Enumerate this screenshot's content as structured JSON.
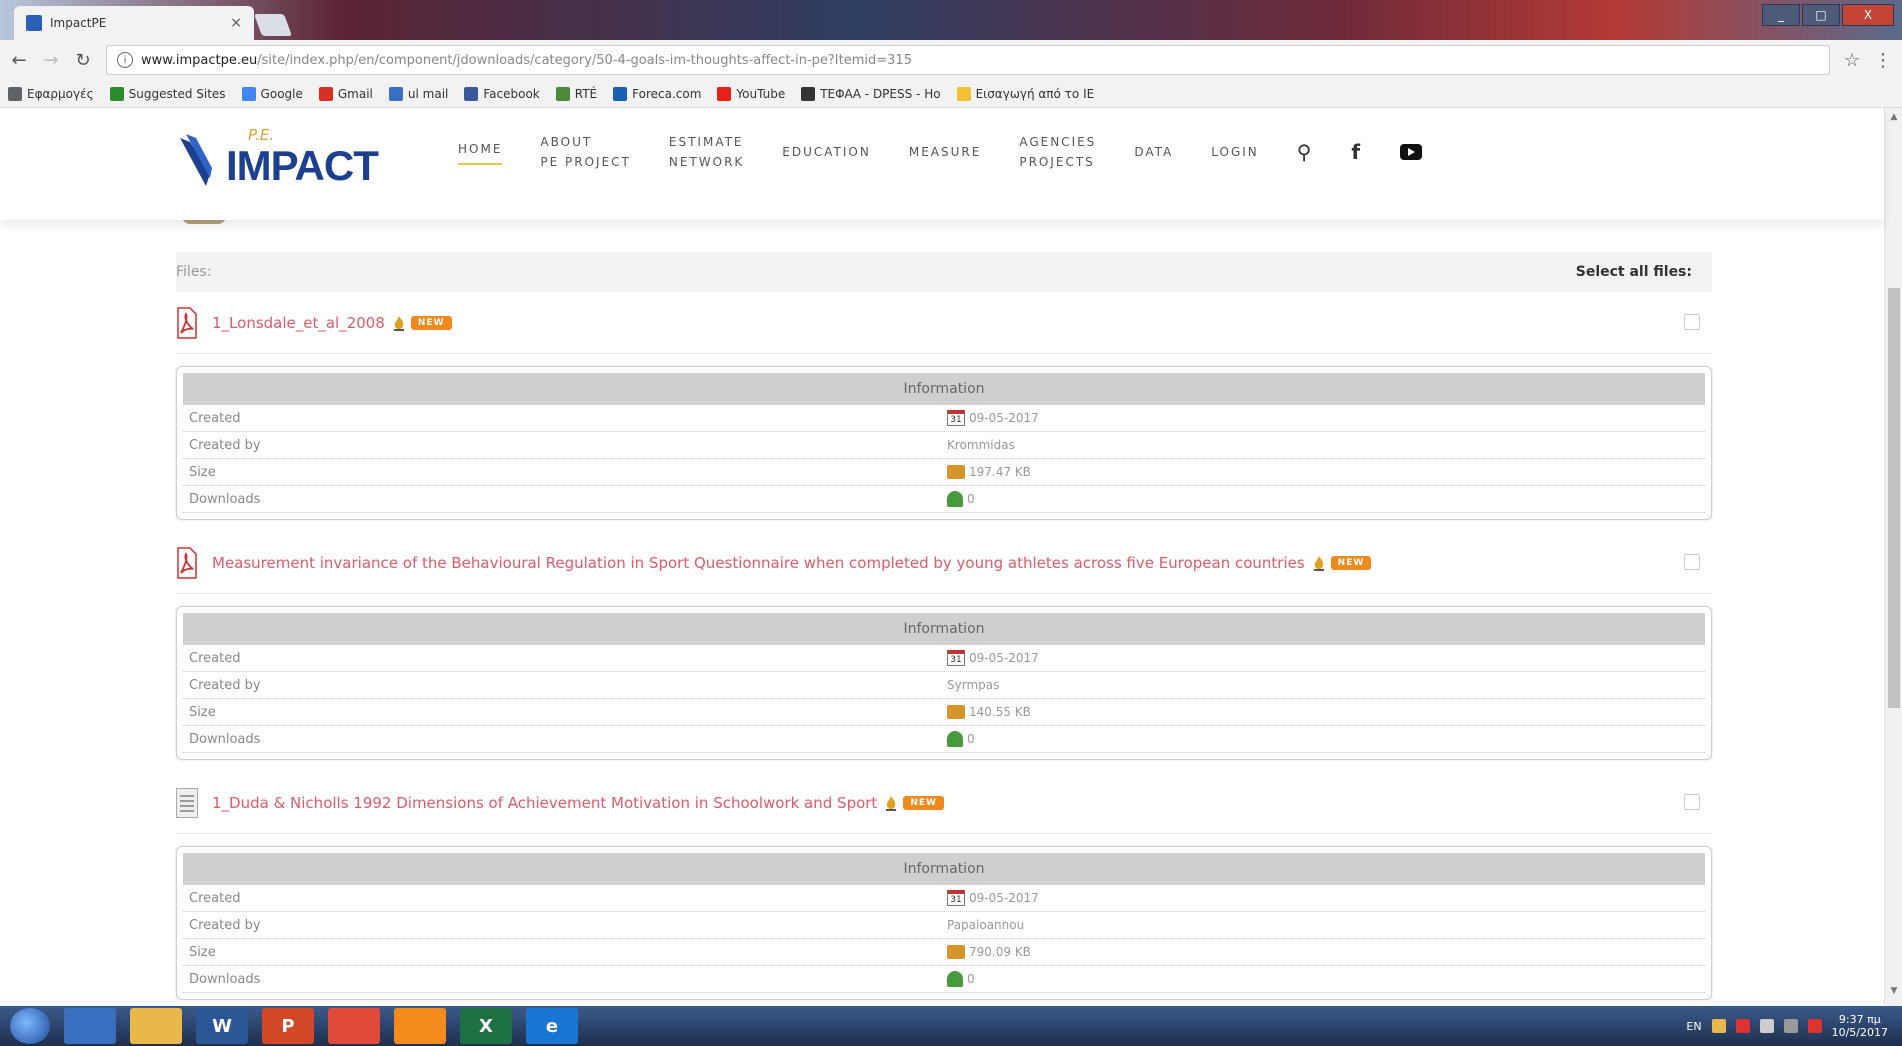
{
  "browser": {
    "tab_title": "ImpactPE",
    "tab_close": "×",
    "url_domain": "www.impactpe.eu",
    "url_path": "/site/index.php/en/component/jdownloads/category/50-4-goals-im-thoughts-affect-in-pe?Itemid=315",
    "window_buttons": [
      "_",
      "□",
      "X"
    ],
    "bookmarks": [
      {
        "label": "Εφαρμογές",
        "color": "#5f6368"
      },
      {
        "label": "Suggested Sites",
        "color": "#2c8c2c"
      },
      {
        "label": "Google",
        "color": "#4285f4"
      },
      {
        "label": "Gmail",
        "color": "#d93025"
      },
      {
        "label": "ul mail",
        "color": "#3a6ec2"
      },
      {
        "label": "Facebook",
        "color": "#3b5998"
      },
      {
        "label": "RTÉ",
        "color": "#4a8a3a"
      },
      {
        "label": "Foreca.com",
        "color": "#1a5fb4"
      },
      {
        "label": "YouTube",
        "color": "#e62117"
      },
      {
        "label": "ΤΕΦΑΑ - DPESS - Ho",
        "color": "#333333"
      },
      {
        "label": "Εισαγωγή από το IE",
        "color": "#f1c232"
      }
    ]
  },
  "site": {
    "logo_pe": "P.E.",
    "logo_text": "IMPACT",
    "nav": [
      {
        "line1": "HOME",
        "line2": ""
      },
      {
        "line1": "ABOUT",
        "line2": "PE PROJECT"
      },
      {
        "line1": "ESTIMATE",
        "line2": "NETWORK"
      },
      {
        "line1": "EDUCATION",
        "line2": ""
      },
      {
        "line1": "MEASURE",
        "line2": ""
      },
      {
        "line1": "AGENCIES",
        "line2": "PROJECTS"
      },
      {
        "line1": "DATA",
        "line2": ""
      },
      {
        "line1": "LOGIN",
        "line2": ""
      }
    ]
  },
  "files_header": {
    "left": "Files:",
    "right": "Select all files:"
  },
  "files": [
    {
      "name": "1_Lonsdale_et_al_2008",
      "type": "pdf",
      "badge": "NEW",
      "info_title": "Information",
      "labels": [
        "Created",
        "Created by",
        "Size",
        "Downloads"
      ],
      "created": "09-05-2017",
      "created_by": "Krommidas",
      "size": "197.47 KB",
      "downloads": "0"
    },
    {
      "name": "Measurement invariance of the Behavioural Regulation in Sport Questionnaire when completed by young athletes across five European countries",
      "type": "pdf",
      "badge": "NEW",
      "info_title": "Information",
      "labels": [
        "Created",
        "Created by",
        "Size",
        "Downloads"
      ],
      "created": "09-05-2017",
      "created_by": "Syrmpas",
      "size": "140.55 KB",
      "downloads": "0"
    },
    {
      "name": "1_Duda & Nicholls 1992 Dimensions of Achievement Motivation in Schoolwork and Sport",
      "type": "doc",
      "badge": "NEW",
      "info_title": "Information",
      "labels": [
        "Created",
        "Created by",
        "Size",
        "Downloads"
      ],
      "created": "09-05-2017",
      "created_by": "Papaioannou",
      "size": "790.09 KB",
      "downloads": "0"
    }
  ],
  "taskbar": {
    "apps": [
      {
        "label": "",
        "color": "#3a6fbf"
      },
      {
        "label": "",
        "color": "#e8b84a"
      },
      {
        "label": "W",
        "color": "#2b5797"
      },
      {
        "label": "P",
        "color": "#d24726"
      },
      {
        "label": "",
        "color": "#e04a3a"
      },
      {
        "label": "",
        "color": "#f28b1c"
      },
      {
        "label": "X",
        "color": "#1e7145"
      },
      {
        "label": "e",
        "color": "#1a74d2"
      }
    ],
    "lang": "EN",
    "time": "9:37 πμ",
    "date": "10/5/2017"
  }
}
